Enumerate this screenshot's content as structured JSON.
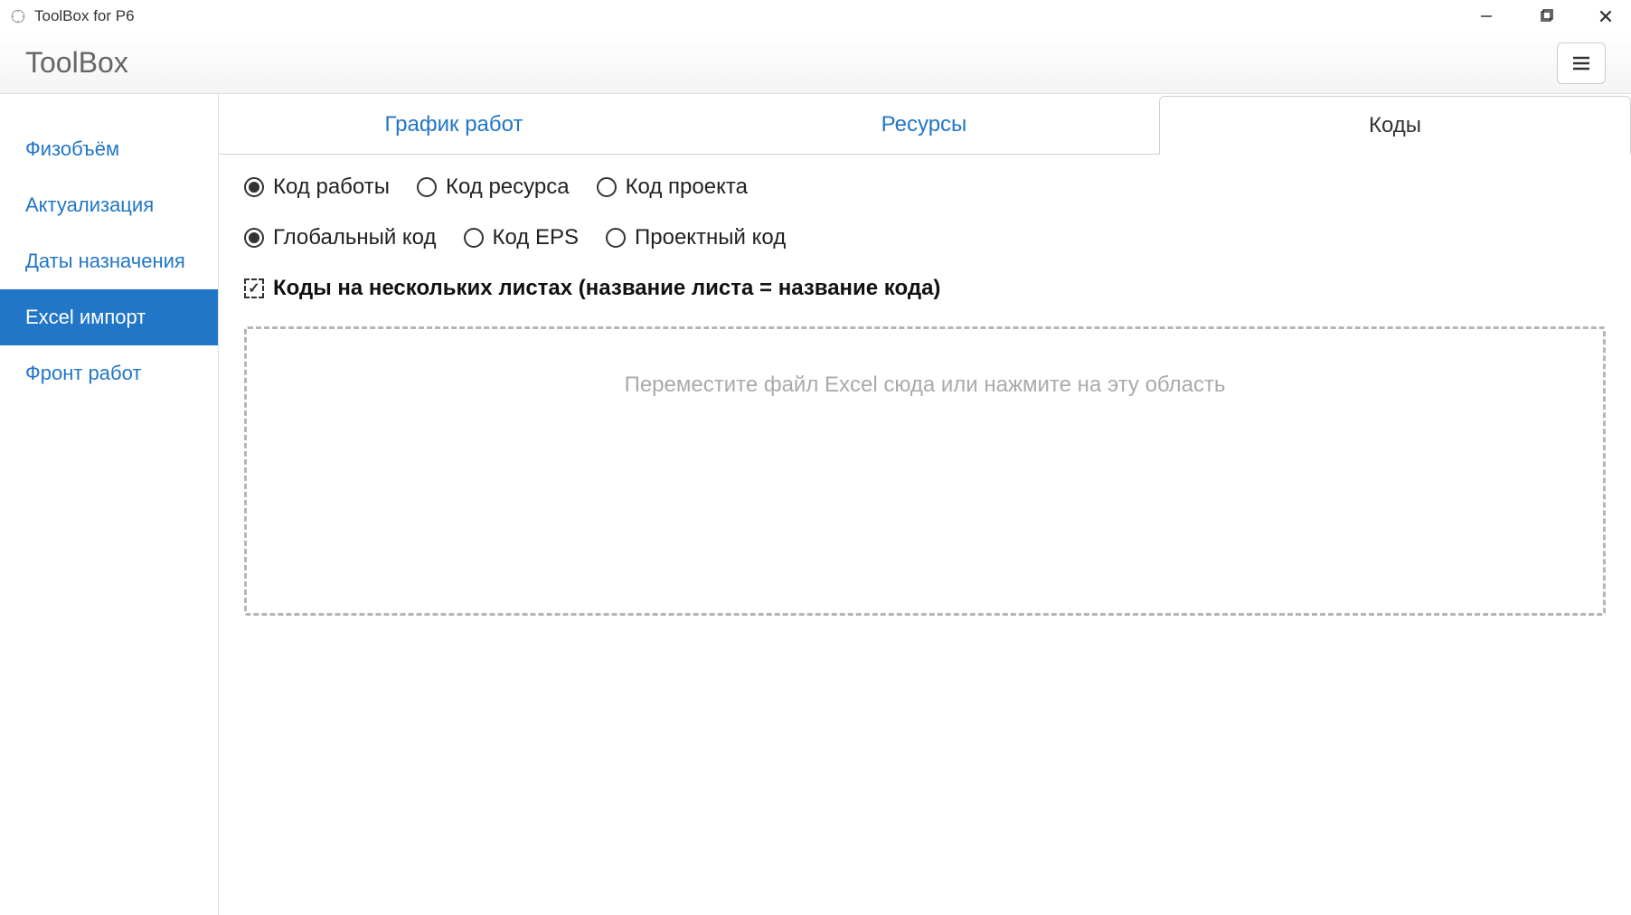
{
  "titlebar": {
    "title": "ToolBox for P6"
  },
  "header": {
    "app_title": "ToolBox"
  },
  "sidebar": {
    "items": [
      {
        "label": "Физобъём",
        "active": false
      },
      {
        "label": "Актуализация",
        "active": false
      },
      {
        "label": "Даты назначения",
        "active": false
      },
      {
        "label": "Excel импорт",
        "active": true
      },
      {
        "label": "Фронт работ",
        "active": false
      }
    ]
  },
  "tabs": [
    {
      "label": "График работ",
      "active": false
    },
    {
      "label": "Ресурсы",
      "active": false
    },
    {
      "label": "Коды",
      "active": true
    }
  ],
  "radio_group_1": [
    {
      "label": "Код работы",
      "checked": true
    },
    {
      "label": "Код ресурса",
      "checked": false
    },
    {
      "label": "Код проекта",
      "checked": false
    }
  ],
  "radio_group_2": [
    {
      "label": "Глобальный код",
      "checked": true
    },
    {
      "label": "Код EPS",
      "checked": false
    },
    {
      "label": "Проектный код",
      "checked": false
    }
  ],
  "checkbox": {
    "label": "Коды на нескольких листах (название листа = название кода)",
    "checked": true
  },
  "dropzone": {
    "text": "Переместите файл Excel сюда или нажмите на эту область"
  }
}
